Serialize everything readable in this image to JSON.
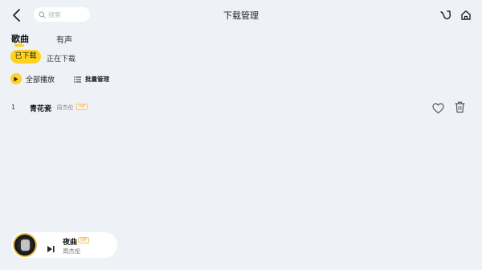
{
  "header": {
    "title": "下载管理",
    "search_placeholder": "搜索",
    "back_icon": "chevron-left-icon",
    "left_action_icon": "music-bird-icon",
    "right_action_icon": "home-icon"
  },
  "tabs": [
    {
      "label": "歌曲",
      "active": true
    },
    {
      "label": "有声",
      "active": false
    }
  ],
  "filters": [
    {
      "label": "已下载",
      "active": true
    },
    {
      "label": "正在下载",
      "active": false
    }
  ],
  "actions": {
    "play_all": "全部播放",
    "batch_manage": "批量管理"
  },
  "songs": [
    {
      "index": "1",
      "title": "青花瓷",
      "artist": "· 周杰伦",
      "badge": "VIP"
    }
  ],
  "player": {
    "title": "夜曲",
    "artist": "周杰伦",
    "badge": "VIP"
  },
  "colors": {
    "accent": "#ffd21f",
    "background": "#eef1f6",
    "vip": "#e0a94a"
  }
}
